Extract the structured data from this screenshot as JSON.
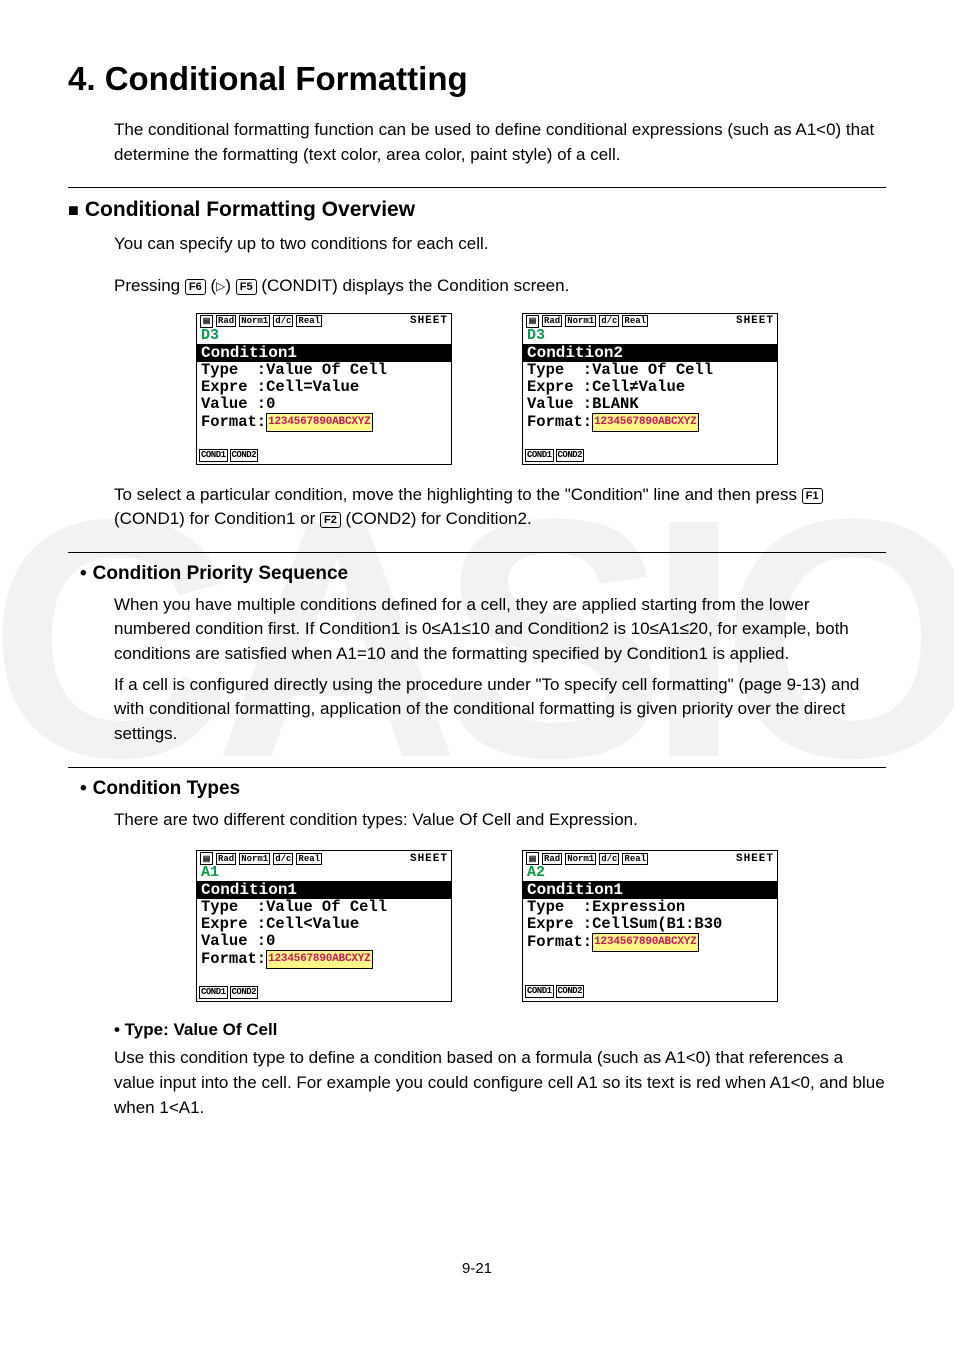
{
  "page": {
    "title": "4. Conditional Formatting",
    "intro": "The conditional formatting function can be used to define conditional expressions (such as A1<0) that determine the formatting (text color, area color, paint style) of a cell.",
    "pagenum": "9-21"
  },
  "overview": {
    "heading": "Conditional Formatting Overview",
    "line1": "You can specify up to two conditions for each cell.",
    "line2a": "Pressing ",
    "key_f6": "F6",
    "tri": "▷",
    "key_f5": "F5",
    "line2b": "(CONDIT) displays the Condition screen.",
    "after1": "To select a particular condition, move the highlighting to the \"Condition\" line and then press ",
    "key_f1": "F1",
    "after1b": "(COND1) for Condition1 or ",
    "key_f2": "F2",
    "after1c": "(COND2) for Condition2."
  },
  "screens": {
    "status_mode": "SHEET",
    "s1": {
      "cell": "D3",
      "header": "Condition1",
      "r1": "Type  :Value Of Cell",
      "r2": "Expre :Cell=Value",
      "r3": "Value :0",
      "fmt": "Format:",
      "fmtval": "1234567890ABCXYZ",
      "fk1": "COND1",
      "fk2": "COND2"
    },
    "s2": {
      "cell": "D3",
      "header": "Condition2",
      "r1": "Type  :Value Of Cell",
      "r2": "Expre :Cell≠Value",
      "r3": "Value :BLANK",
      "fmt": "Format:",
      "fmtval": "1234567890ABCXYZ",
      "fk1": "COND1",
      "fk2": "COND2"
    },
    "s3": {
      "cell": "A1",
      "header": "Condition1",
      "r1": "Type  :Value Of Cell",
      "r2": "Expre :Cell<Value",
      "r3": "Value :0",
      "fmt": "Format:",
      "fmtval": "1234567890ABCXYZ",
      "fk1": "COND1",
      "fk2": "COND2"
    },
    "s4": {
      "cell": "A2",
      "header": "Condition1",
      "r1": "Type  :Expression",
      "r2": "Expre :CellSum(B1:B30",
      "fmt": "Format:",
      "fmtval": "1234567890ABCXYZ",
      "fk1": "COND1",
      "fk2": "COND2"
    }
  },
  "priority": {
    "heading": "Condition Priority Sequence",
    "p1": "When you have multiple conditions defined for a cell, they are applied starting from the lower numbered condition first. If Condition1 is 0≤A1≤10 and Condition2 is 10≤A1≤20, for example, both conditions are satisfied when A1=10 and the formatting specified by Condition1 is applied.",
    "p2": "If a cell is configured directly using the procedure under \"To specify cell formatting\" (page 9-13) and with conditional formatting, application of the conditional formatting is given priority over the direct settings."
  },
  "types": {
    "heading": "Condition Types",
    "intro": "There are two different condition types: Value Of Cell and Expression.",
    "sub1_title": "• Type: Value Of Cell",
    "sub1_body": "Use this condition type to define a condition based on a formula (such as A1<0) that references a value input into the cell. For example you could configure cell A1 so its text is red when A1<0, and blue when 1<A1."
  }
}
